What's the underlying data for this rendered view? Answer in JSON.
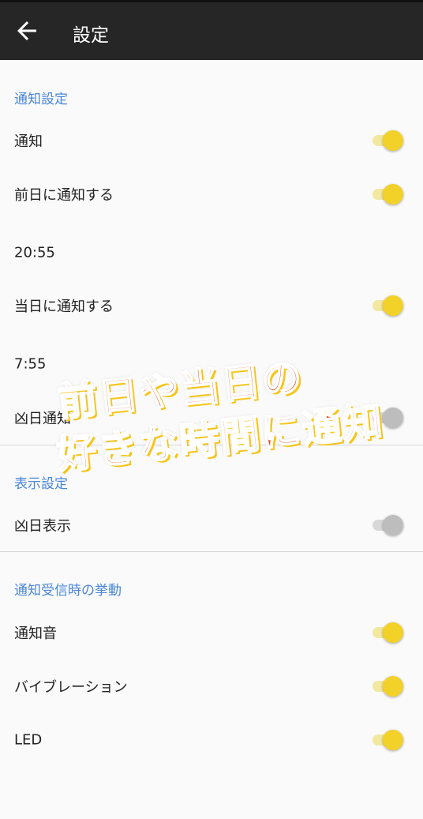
{
  "appbar": {
    "title": "設定",
    "back_icon": "arrow-left-icon"
  },
  "sections": {
    "notify": {
      "header": "通知設定",
      "notify_label": "通知",
      "prev_day_label": "前日に通知する",
      "prev_day_time": "20:55",
      "same_day_label": "当日に通知する",
      "same_day_time": "7:55",
      "bad_day_label": "凶日通知"
    },
    "display": {
      "header": "表示設定",
      "bad_day_display_label": "凶日表示"
    },
    "behavior": {
      "header": "通知受信時の挙動",
      "sound_label": "通知音",
      "vibration_label": "バイブレーション",
      "led_label": "LED"
    }
  },
  "toggles": {
    "notify": true,
    "prev_day": true,
    "same_day": true,
    "bad_day_notify": false,
    "bad_day_display": false,
    "sound": true,
    "vibration": true,
    "led": true
  },
  "overlay": {
    "line1": "前日や当日の",
    "line2": "好きな時間に通知"
  },
  "colors": {
    "accent": "#f2d129",
    "section_header": "#4a86d8",
    "appbar": "#262626",
    "overlay_text": "#ea4f24"
  }
}
